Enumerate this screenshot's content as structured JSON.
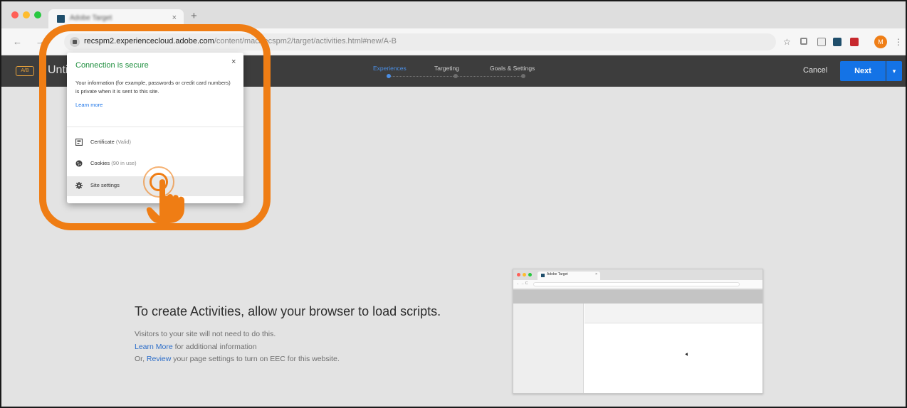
{
  "browser": {
    "tab": {
      "title": "Adobe Target",
      "close": "×"
    },
    "new_tab": "+",
    "nav": {
      "back": "←",
      "forward": "→"
    },
    "url": {
      "domain": "recspm2.experiencecloud.adobe.com",
      "path": "/content/mac/recspm2/target/activities.html#new/A-B"
    },
    "toolbar_icons": [
      "star-icon",
      "extension-icon",
      "cast-icon",
      "adobe-ext-icon",
      "red-ext-icon",
      "profile-avatar",
      "menu-icon"
    ],
    "star": "☆",
    "avatar_initial": "M",
    "menu": "⋮"
  },
  "app_header": {
    "badge": "A/B",
    "activity_title": "Untitled Activity",
    "steps": [
      {
        "label": "Experiences",
        "active": true
      },
      {
        "label": "Targeting",
        "active": false
      },
      {
        "label": "Goals & Settings",
        "active": false
      }
    ],
    "cancel_label": "Cancel",
    "next_label": "Next",
    "next_dropdown": "▾",
    "accent_color": "#1473e6"
  },
  "security_popup": {
    "title": "Connection is secure",
    "close": "×",
    "description": "Your information (for example, passwords or credit card numbers) is private when it is sent to this site.",
    "learn_more": "Learn more",
    "rows": [
      {
        "icon": "certificate-icon",
        "label": "Certificate",
        "detail": "(Valid)"
      },
      {
        "icon": "cookie-icon",
        "label": "Cookies",
        "detail": "(90 in use)"
      },
      {
        "icon": "gear-icon",
        "label": "Site settings",
        "detail": ""
      }
    ],
    "title_color": "#1e8e3e"
  },
  "message": {
    "title": "To create Activities, allow your browser to load scripts.",
    "line1": "Visitors to your site will not need to do this.",
    "line2_link": "Learn More",
    "line2_rest": " for additional information",
    "line3_pre": "Or, ",
    "line3_link": "Review",
    "line3_rest": " your page settings to turn on EEC for this website."
  },
  "mini_browser": {
    "tab_title": "Adobe Target",
    "close": "×",
    "nav": "← → C"
  },
  "annotation": {
    "highlight_color": "#ef7d14",
    "gesture": "tap"
  }
}
